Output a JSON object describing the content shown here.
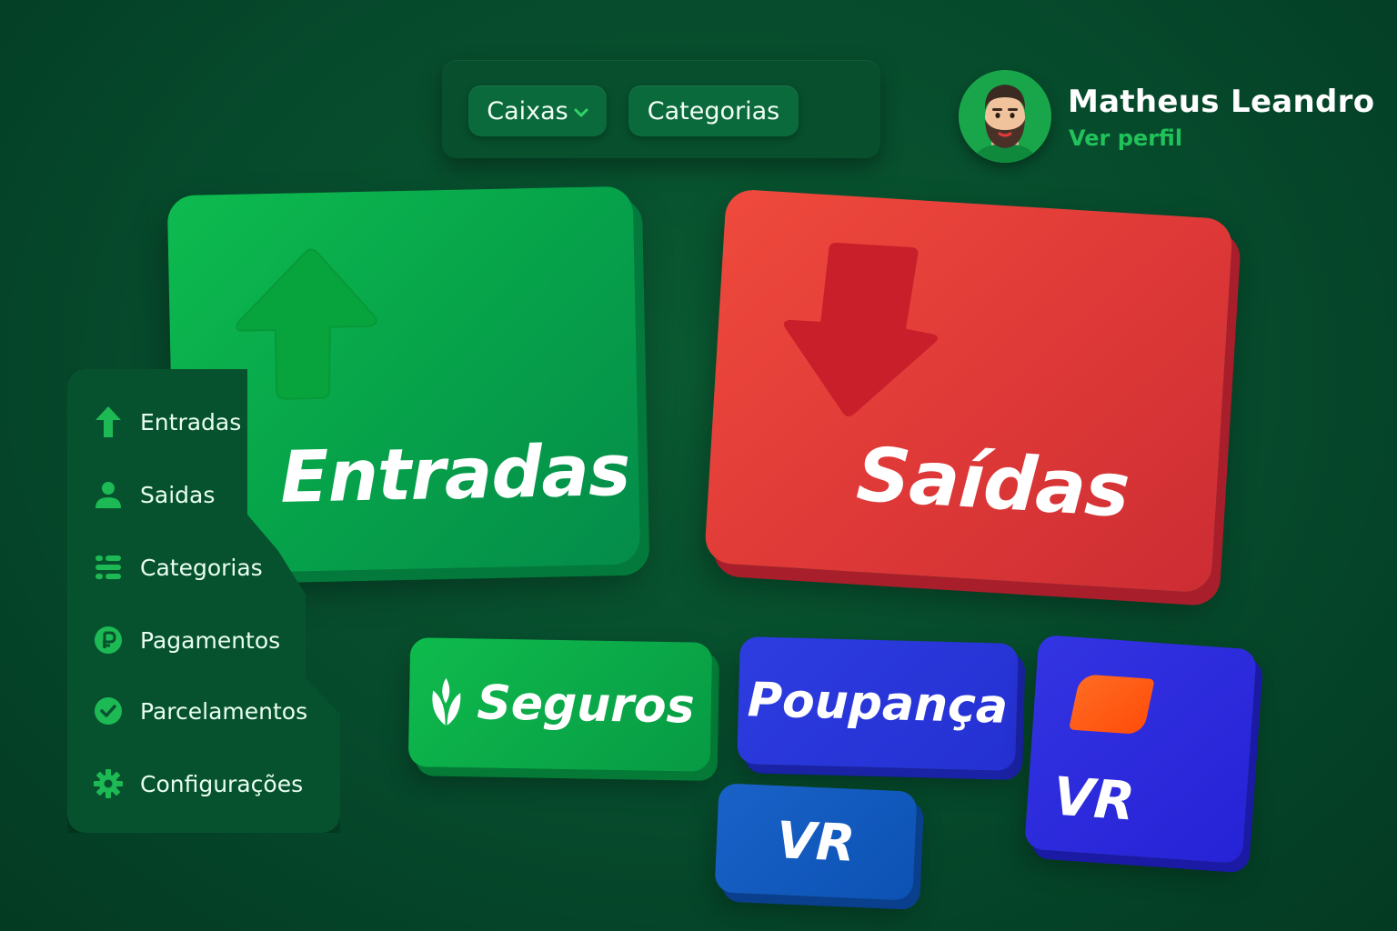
{
  "nav": {
    "items": [
      {
        "label": "Caixas",
        "has_dropdown": true
      },
      {
        "label": "Categorias",
        "has_dropdown": false
      }
    ]
  },
  "profile": {
    "name": "Matheus Leandro",
    "link": "Ver perfil"
  },
  "cards": {
    "entradas": {
      "label": "Entradas",
      "color": "#0ebb4f",
      "icon": "arrow-up-icon"
    },
    "saidas": {
      "label": "Saídas",
      "color": "#e03a38",
      "icon": "arrow-down-icon"
    }
  },
  "tiles": {
    "seguros": {
      "label": "Seguros",
      "icon": "leaf-icon",
      "color": "#0fbb4d"
    },
    "poupanca": {
      "label": "Poupança",
      "color": "#2d3de0"
    },
    "vr_small": {
      "label": "VR",
      "color": "#1a62c8"
    },
    "vr_big": {
      "label": "VR",
      "logo_color": "#ff5a14",
      "color": "#2c2bdc"
    }
  },
  "sidebar": {
    "items": [
      {
        "label": "Entradas",
        "icon": "arrow-up-icon"
      },
      {
        "label": "Saidas",
        "icon": "person-icon"
      },
      {
        "label": "Categorias",
        "icon": "list-icon"
      },
      {
        "label": "Pagamentos",
        "icon": "currency-icon"
      },
      {
        "label": "Parcelamentos",
        "icon": "check-circle-icon"
      },
      {
        "label": "Configurações",
        "icon": "gear-icon"
      }
    ]
  }
}
